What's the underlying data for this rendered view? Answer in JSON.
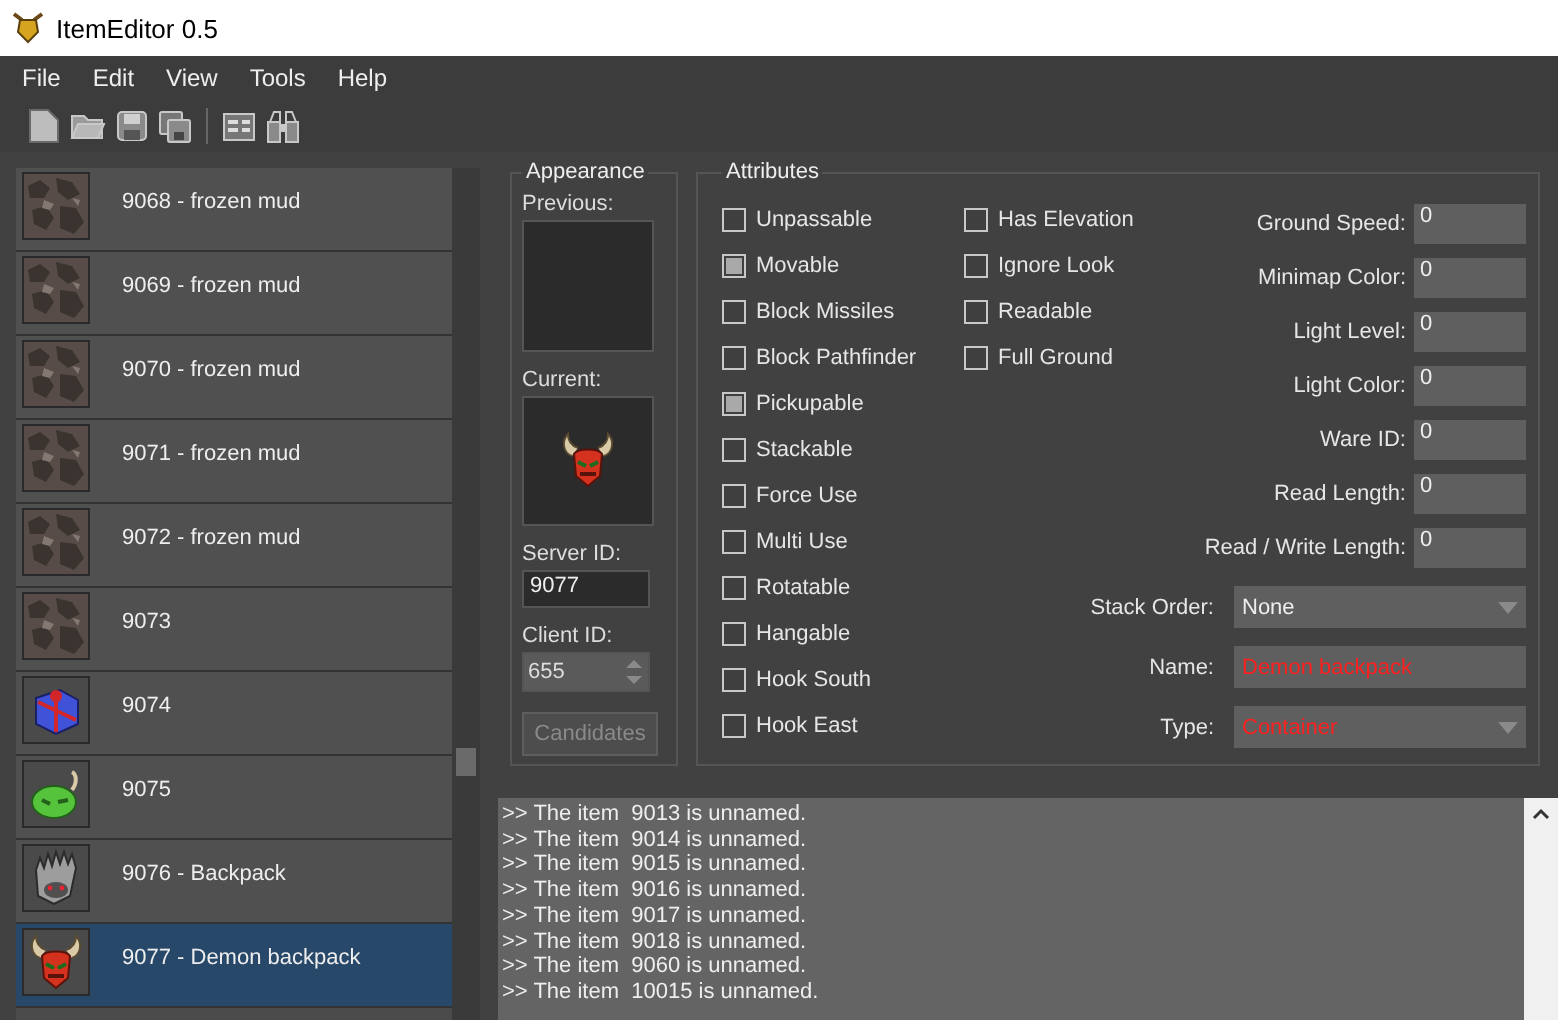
{
  "window": {
    "title": "ItemEditor 0.5"
  },
  "menu": [
    "File",
    "Edit",
    "View",
    "Tools",
    "Help"
  ],
  "toolbar": [
    {
      "kind": "new"
    },
    {
      "kind": "open"
    },
    {
      "kind": "save"
    },
    {
      "kind": "save-all"
    },
    {
      "kind": "panel"
    },
    {
      "kind": "find"
    }
  ],
  "item_list": {
    "items": [
      {
        "label": "9068 - frozen mud",
        "kind": "mud",
        "selected": false
      },
      {
        "label": "9069 - frozen mud",
        "kind": "mud",
        "selected": false
      },
      {
        "label": "9070 - frozen mud",
        "kind": "mud",
        "selected": false
      },
      {
        "label": "9071 - frozen mud",
        "kind": "mud",
        "selected": false
      },
      {
        "label": "9072 - frozen mud",
        "kind": "mud",
        "selected": false
      },
      {
        "label": "9073",
        "kind": "mud",
        "selected": false
      },
      {
        "label": "9074",
        "kind": "gift",
        "selected": false
      },
      {
        "label": "9075",
        "kind": "green-bag",
        "selected": false
      },
      {
        "label": "9076 - Backpack",
        "kind": "backpack",
        "selected": false
      },
      {
        "label": "9077 - Demon backpack",
        "kind": "demon-bag",
        "selected": true
      }
    ]
  },
  "appearance": {
    "title": "Appearance",
    "previous_label": "Previous:",
    "current_label": "Current:",
    "current_preview": {
      "kind": "demon-bag"
    },
    "server_id_label": "Server ID:",
    "server_id": "9077",
    "client_id_label": "Client ID:",
    "client_id": "655",
    "candidates_button": {
      "label": "Candidates",
      "disabled": true
    }
  },
  "attributes": {
    "title": "Attributes",
    "flag_columns": [
      [
        {
          "label": "Unpassable",
          "checked": false
        },
        {
          "label": "Movable",
          "checked": true
        },
        {
          "label": "Block Missiles",
          "checked": false
        },
        {
          "label": "Block Pathfinder",
          "checked": false
        },
        {
          "label": "Pickupable",
          "checked": true
        },
        {
          "label": "Stackable",
          "checked": false
        },
        {
          "label": "Force Use",
          "checked": false
        },
        {
          "label": "Multi Use",
          "checked": false
        },
        {
          "label": "Rotatable",
          "checked": false
        },
        {
          "label": "Hangable",
          "checked": false
        },
        {
          "label": "Hook South",
          "checked": false
        },
        {
          "label": "Hook East",
          "checked": false
        }
      ],
      [
        {
          "label": "Has Elevation",
          "checked": false
        },
        {
          "label": "Ignore Look",
          "checked": false
        },
        {
          "label": "Readable",
          "checked": false
        },
        {
          "label": "Full Ground",
          "checked": false
        }
      ]
    ],
    "fields": [
      {
        "label": "Ground Speed:",
        "value": "0"
      },
      {
        "label": "Minimap Color:",
        "value": "0"
      },
      {
        "label": "Light Level:",
        "value": "0"
      },
      {
        "label": "Light Color:",
        "value": "0"
      },
      {
        "label": "Ware ID:",
        "value": "0"
      },
      {
        "label": "Read Length:",
        "value": "0"
      },
      {
        "label": "Read / Write Length:",
        "value": "0"
      }
    ],
    "wide_fields": [
      {
        "kind": "dropdown",
        "label": "Stack Order:",
        "value": "None",
        "highlighted": false
      },
      {
        "kind": "text",
        "label": "Name:",
        "value": "Demon backpack",
        "highlighted": true
      },
      {
        "kind": "dropdown",
        "label": "Type:",
        "value": "Container",
        "highlighted": true
      }
    ]
  },
  "log": {
    "lines": [
      ">> The item  9013 is unnamed.",
      ">> The item  9014 is unnamed.",
      ">> The item  9015 is unnamed.",
      ">> The item  9016 is unnamed.",
      ">> The item  9017 is unnamed.",
      ">> The item  9018 is unnamed.",
      ">> The item  9060 is unnamed.",
      ">> The item  10015 is unnamed."
    ]
  }
}
